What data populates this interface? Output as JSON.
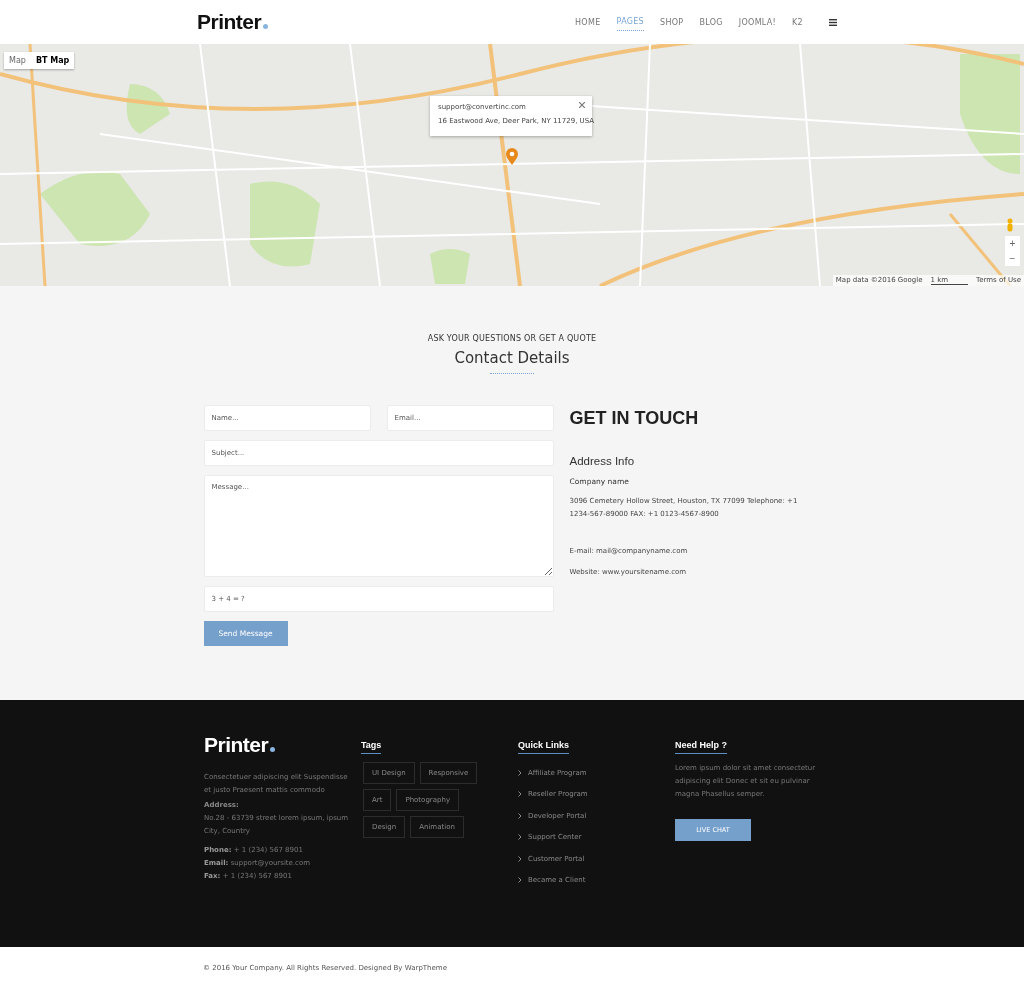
{
  "header": {
    "logo": "Printer",
    "nav": [
      {
        "label": "HOME",
        "selected": false
      },
      {
        "label": "PAGES",
        "selected": true
      },
      {
        "label": "SHOP",
        "selected": false
      },
      {
        "label": "BLOG",
        "selected": false
      },
      {
        "label": "JOOMLA!",
        "selected": false
      },
      {
        "label": "K2",
        "selected": false
      }
    ]
  },
  "map": {
    "types": [
      {
        "label": "Map",
        "selected": false
      },
      {
        "label": "BT Map",
        "selected": true
      }
    ],
    "info_window": {
      "email": "support@convertinc.com",
      "address": "16 Eastwood Ave, Deer Park, NY 11729, USA"
    },
    "zoom_in": "+",
    "zoom_out": "−",
    "attribution": "Map data ©2016 Google",
    "scale": "1 km",
    "terms": "Terms of Use"
  },
  "contact": {
    "kicker": "ASK YOUR QUESTIONS OR GET A QUOTE",
    "title": "Contact Details",
    "form": {
      "name": {
        "placeholder": "Name..."
      },
      "email": {
        "placeholder": "Email..."
      },
      "subject": {
        "placeholder": "Subject..."
      },
      "message": {
        "placeholder": "Message..."
      },
      "captcha": {
        "placeholder": "3 + 4 = ?"
      },
      "submit": "Send Message"
    },
    "info": {
      "heading": "GET IN TOUCH",
      "subheading": "Address Info",
      "company": "Company name",
      "address": "3096 Cemetery Hollow Street, Houston, TX 77099 Telephone: +1 1234-567-89000 FAX: +1 0123-4567-8900",
      "email": "E-mail: mail@companyname.com",
      "website": "Website: www.yoursitename.com"
    }
  },
  "footer": {
    "logo": "Printer",
    "about": "Consectetuer adipiscing elit Suspendisse et justo Praesent mattis commodo",
    "address_label": "Address:",
    "address": "No.28 - 63739 street lorem ipsum, ipsum City, Country",
    "contacts": [
      "**Phone:** + 1 (234) 567 8901",
      "**Email:** support@yoursite.com",
      "**Fax:** + 1 (234) 567 8901"
    ],
    "tags_title": "Tags",
    "tags": [
      "UI Design",
      "Responsive",
      "Art",
      "Photography",
      "Design",
      "Animation"
    ],
    "links_title": "Quick Links",
    "links": [
      "Affiliate Program",
      "Reseller Program",
      "Developer Portal",
      "Support Center",
      "Customer Portal",
      "Became a Client"
    ],
    "help_title": "Need Help ?",
    "help_text": "Lorem ipsum dolor sit amet consectetur adipiscing elit Donec et sit eu pulvinar magna Phasellus semper.",
    "help_button": "LIVE CHAT"
  },
  "copyright": "© 2016 Your Company. All Rights Reserved. Designed By WarpTheme"
}
